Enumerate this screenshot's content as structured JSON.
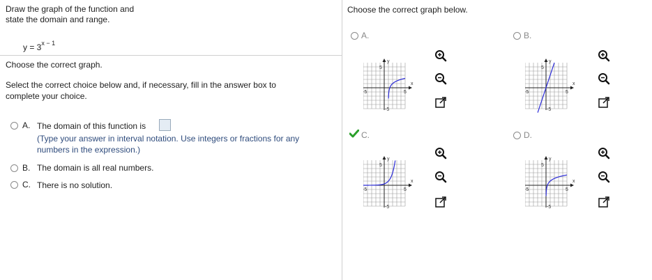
{
  "question": {
    "instruction_line1": "Draw the graph of the function and",
    "instruction_line2": "state the domain and range.",
    "equation_prefix": "y = 3",
    "equation_exponent": "x − 1",
    "part_title": "Choose the correct graph.",
    "select_line1": "Select the correct choice below and, if necessary, fill in the answer box to",
    "select_line2": "complete your choice."
  },
  "domain_choices": [
    {
      "letter": "A.",
      "text": "The domain of this function is",
      "hint_line1": "(Type your answer in interval notation. Use integers or fractions for any",
      "hint_line2": "numbers in the expression.)"
    },
    {
      "letter": "B.",
      "text": "The domain is all real numbers."
    },
    {
      "letter": "C.",
      "text": "There is no solution."
    }
  ],
  "graph_panel": {
    "prompt": "Choose the correct graph below.",
    "options": [
      {
        "letter": "A.",
        "selected": false
      },
      {
        "letter": "B.",
        "selected": false
      },
      {
        "letter": "C.",
        "selected": true
      },
      {
        "letter": "D.",
        "selected": false
      }
    ],
    "axis_labels": {
      "x": "x",
      "y": "y",
      "tick_pos": "5",
      "tick_neg": "-5"
    }
  },
  "colors": {
    "curve": "#2b2bd8",
    "grid": "#9a9a9a",
    "check": "#2ba02b",
    "hint": "#2e4b7c"
  },
  "icons": [
    "zoom-in-icon",
    "zoom-out-icon",
    "expand-icon",
    "check-icon"
  ]
}
